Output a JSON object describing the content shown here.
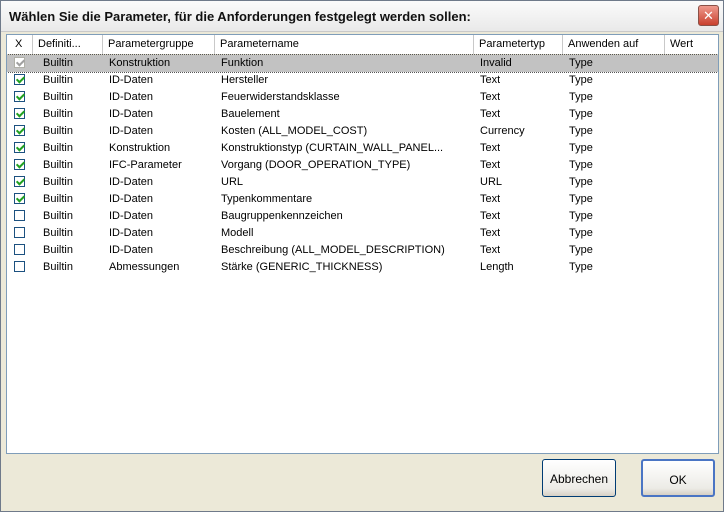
{
  "dialog": {
    "title": "Wählen Sie die Parameter, für die Anforderungen festgelegt werden sollen:",
    "close_glyph": "✕"
  },
  "columns": {
    "check": "X",
    "definition": "Definiti...",
    "group": "Parametergruppe",
    "name": "Parametername",
    "type": "Parametertyp",
    "apply": "Anwenden auf",
    "value": "Wert"
  },
  "rows": [
    {
      "checked": true,
      "disabled": true,
      "selected": true,
      "definition": "Builtin",
      "group": "Konstruktion",
      "name": "Funktion",
      "type": "Invalid",
      "apply": "Type"
    },
    {
      "checked": true,
      "definition": "Builtin",
      "group": "ID-Daten",
      "name": "Hersteller",
      "type": "Text",
      "apply": "Type"
    },
    {
      "checked": true,
      "definition": "Builtin",
      "group": "ID-Daten",
      "name": "Feuerwiderstandsklasse",
      "type": "Text",
      "apply": "Type"
    },
    {
      "checked": true,
      "definition": "Builtin",
      "group": "ID-Daten",
      "name": "Bauelement",
      "type": "Text",
      "apply": "Type"
    },
    {
      "checked": true,
      "definition": "Builtin",
      "group": "ID-Daten",
      "name": "Kosten (ALL_MODEL_COST)",
      "type": "Currency",
      "apply": "Type"
    },
    {
      "checked": true,
      "definition": "Builtin",
      "group": "Konstruktion",
      "name": "Konstruktionstyp (CURTAIN_WALL_PANEL...",
      "type": "Text",
      "apply": "Type"
    },
    {
      "checked": true,
      "definition": "Builtin",
      "group": "IFC-Parameter",
      "name": "Vorgang (DOOR_OPERATION_TYPE)",
      "type": "Text",
      "apply": "Type"
    },
    {
      "checked": true,
      "definition": "Builtin",
      "group": "ID-Daten",
      "name": "URL",
      "type": "URL",
      "apply": "Type"
    },
    {
      "checked": true,
      "definition": "Builtin",
      "group": "ID-Daten",
      "name": "Typenkommentare",
      "type": "Text",
      "apply": "Type"
    },
    {
      "checked": false,
      "definition": "Builtin",
      "group": "ID-Daten",
      "name": "Baugruppenkennzeichen",
      "type": "Text",
      "apply": "Type"
    },
    {
      "checked": false,
      "definition": "Builtin",
      "group": "ID-Daten",
      "name": "Modell",
      "type": "Text",
      "apply": "Type"
    },
    {
      "checked": false,
      "definition": "Builtin",
      "group": "ID-Daten",
      "name": "Beschreibung (ALL_MODEL_DESCRIPTION)",
      "type": "Text",
      "apply": "Type"
    },
    {
      "checked": false,
      "definition": "Builtin",
      "group": "Abmessungen",
      "name": "Stärke (GENERIC_THICKNESS)",
      "type": "Length",
      "apply": "Type"
    }
  ],
  "buttons": {
    "cancel": "Abbrechen",
    "ok": "OK"
  }
}
